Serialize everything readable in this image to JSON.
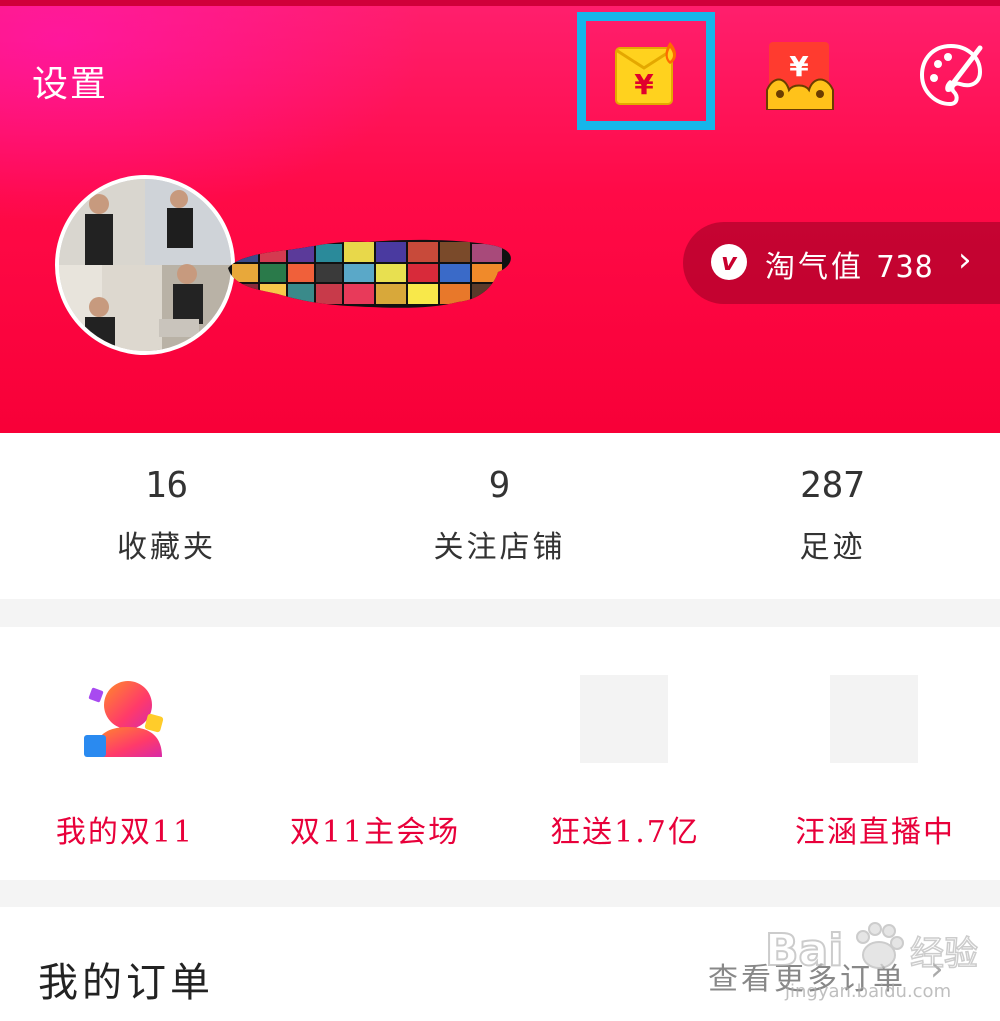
{
  "header": {
    "settings_label": "设置",
    "icons": [
      "red-packet-icon",
      "money-bag-icon",
      "palette-icon"
    ]
  },
  "profile": {
    "taoqi_label": "淘气值",
    "taoqi_value": "738"
  },
  "stats": [
    {
      "value": "16",
      "label": "收藏夹"
    },
    {
      "value": "9",
      "label": "关注店铺"
    },
    {
      "value": "287",
      "label": "足迹"
    }
  ],
  "promos": [
    {
      "label": "我的双11"
    },
    {
      "label": "双11主会场"
    },
    {
      "label": "狂送1.7亿"
    },
    {
      "label": "汪涵直播中"
    }
  ],
  "orders": {
    "title": "我的订单",
    "more_label": "查看更多订单"
  },
  "watermark": {
    "brand": "Bai",
    "brand_suffix": "经验",
    "url": "jingyan.baidu.com"
  },
  "colors": {
    "hero_start": "#ff1f6e",
    "hero_end": "#f80038",
    "promo_text": "#e8003a",
    "highlight_box": "#16b6ea"
  }
}
